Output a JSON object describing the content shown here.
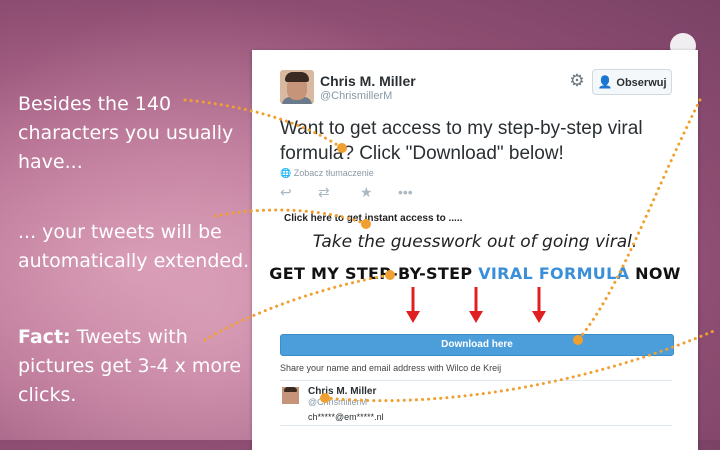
{
  "captions": {
    "first": "Besides the 140 characters you usually have...",
    "second": "... your tweets will be automatically extended.",
    "third_bold": "Fact:",
    "third_rest": " Tweets with pictures get 3-4 x more clicks."
  },
  "tweet": {
    "author_name": "Chris M. Miller",
    "author_handle": "@ChrismillerM",
    "follow_label": "Obserwuj",
    "text": "Want to get access to my step-by-step viral formula? Click \"Download\" below!",
    "translate": "Zobacz tłumaczenie",
    "icons": [
      "reply-icon",
      "retweet-icon",
      "favorite-icon",
      "more-icon",
      "gear-icon",
      "follow-user-icon"
    ]
  },
  "card": {
    "small_text": "Click here to get instant access to .....",
    "italic_text": "Take the guesswork out of going viral.",
    "big_text_start": "GET MY STEP-BY-STEP ",
    "big_text_highlight": "VIRAL FORMULA",
    "big_text_end": " NOW",
    "download_label": "Download here",
    "share_text": "Share your name and email address with Wilco de Kreij",
    "user_name": "Chris M. Miller",
    "user_handle": "@ChrismillerM",
    "user_email": "ch*****@em*****.nl"
  },
  "colors": {
    "arrow_red": "#e02020",
    "dot_orange": "#f0a030",
    "button_blue": "#4b9ed9",
    "highlight_blue": "#3a8fd8"
  }
}
